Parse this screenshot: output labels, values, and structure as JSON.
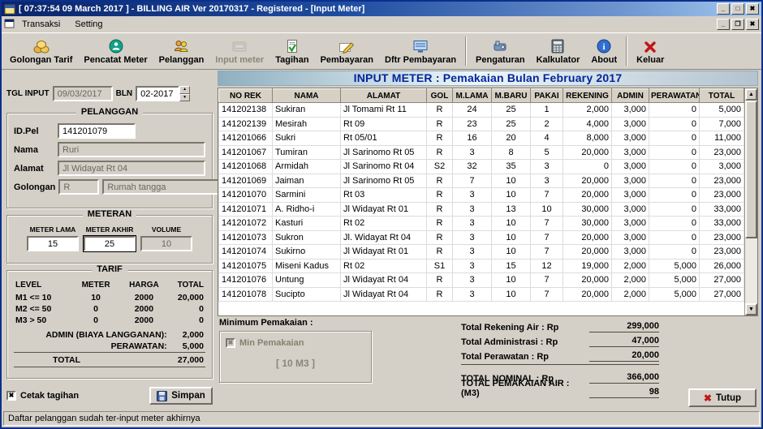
{
  "colors": {
    "titlebar_blue": "#0a246a",
    "header_text_navy": "#00259e",
    "grid_header_bg": "#d6d1c4",
    "close_red": "#c11616",
    "panel_gray": "#d4d0c8"
  },
  "titlebar": {
    "title": "[ 07:37:54  09 March 2017 ]  -  BILLING AIR Ver 20170317  -  Registered - [Input Meter]"
  },
  "menubar": {
    "items": [
      "Transaksi",
      "Setting"
    ]
  },
  "toolbar": {
    "buttons": [
      {
        "label": "Golongan Tarif",
        "icon": "coins-icon"
      },
      {
        "label": "Pencatat Meter",
        "icon": "recorder-icon"
      },
      {
        "label": "Pelanggan",
        "icon": "customers-icon"
      },
      {
        "label": "Input meter",
        "icon": "meter-icon",
        "disabled": true
      },
      {
        "label": "Tagihan",
        "icon": "invoice-check-icon"
      },
      {
        "label": "Pembayaran",
        "icon": "pencil-payment-icon"
      },
      {
        "label": "Dftr Pembayaran",
        "icon": "payment-list-icon"
      },
      {
        "label": "Pengaturan",
        "icon": "settings-tools-icon"
      },
      {
        "label": "Kalkulator",
        "icon": "calculator-icon"
      },
      {
        "label": "About",
        "icon": "info-icon"
      },
      {
        "label": "Keluar",
        "icon": "exit-x-icon"
      }
    ]
  },
  "header": {
    "title": "INPUT METER : Pemakaian Bulan February 2017"
  },
  "form": {
    "tgl_input_label": "TGL INPUT",
    "tgl_input_value": "09/03/2017",
    "bln_label": "BLN",
    "bln_value": "02-2017",
    "pelanggan": {
      "title": "PELANGGAN",
      "id_label": "ID.Pel",
      "id_value": "141201079",
      "nama_label": "Nama",
      "nama_value": "Ruri",
      "alamat_label": "Alamat",
      "alamat_value": "Jl Widayat Rt 04",
      "golongan_label": "Golongan",
      "golongan_code": "R",
      "golongan_name": "Rumah tangga"
    },
    "meteran": {
      "title": "METERAN",
      "meter_lama_label": "METER LAMA",
      "meter_akhir_label": "METER AKHIR",
      "volume_label": "VOLUME",
      "meter_lama": "15",
      "meter_akhir": "25",
      "volume": "10"
    },
    "tarif": {
      "title": "TARIF",
      "headers": [
        "LEVEL",
        "METER",
        "HARGA",
        "TOTAL"
      ],
      "rows": [
        [
          "M1 <= 10",
          "10",
          "2000",
          "20,000"
        ],
        [
          "M2 <= 50",
          "0",
          "2000",
          "0"
        ],
        [
          "M3 > 50",
          "0",
          "2000",
          "0"
        ]
      ],
      "admin_label": "ADMIN (BIAYA LANGGANAN):",
      "admin_value": "2,000",
      "perawatan_label": "PERAWATAN:",
      "perawatan_value": "5,000",
      "total_label": "TOTAL",
      "total_value": "27,000"
    },
    "cetak_label": "Cetak tagihan",
    "simpan_label": "Simpan"
  },
  "grid": {
    "columns": [
      "NO REK",
      "NAMA",
      "ALAMAT",
      "GOL",
      "M.LAMA",
      "M.BARU",
      "PAKAI",
      "REKENING",
      "ADMIN",
      "PERAWATAN",
      "TOTAL"
    ],
    "rows": [
      [
        "141202138",
        "Sukiran",
        "Jl Tomami Rt 11",
        "R",
        "24",
        "25",
        "1",
        "2,000",
        "3,000",
        "0",
        "5,000"
      ],
      [
        "141202139",
        "Mesirah",
        "Rt 09",
        "R",
        "23",
        "25",
        "2",
        "4,000",
        "3,000",
        "0",
        "7,000"
      ],
      [
        "141201066",
        "Sukri",
        "Rt 05/01",
        "R",
        "16",
        "20",
        "4",
        "8,000",
        "3,000",
        "0",
        "11,000"
      ],
      [
        "141201067",
        "Tumiran",
        "Jl Sarinomo Rt 05",
        "R",
        "3",
        "8",
        "5",
        "20,000",
        "3,000",
        "0",
        "23,000"
      ],
      [
        "141201068",
        "Armidah",
        "Jl Sarinomo Rt 04",
        "S2",
        "32",
        "35",
        "3",
        "0",
        "3,000",
        "0",
        "3,000"
      ],
      [
        "141201069",
        "Jaiman",
        "Jl Sarinomo Rt 05",
        "R",
        "7",
        "10",
        "3",
        "20,000",
        "3,000",
        "0",
        "23,000"
      ],
      [
        "141201070",
        "Sarmini",
        "Rt 03",
        "R",
        "3",
        "10",
        "7",
        "20,000",
        "3,000",
        "0",
        "23,000"
      ],
      [
        "141201071",
        "A. Ridho-i",
        "Jl Widayat Rt 01",
        "R",
        "3",
        "13",
        "10",
        "30,000",
        "3,000",
        "0",
        "33,000"
      ],
      [
        "141201072",
        "Kasturi",
        "Rt 02",
        "R",
        "3",
        "10",
        "7",
        "30,000",
        "3,000",
        "0",
        "33,000"
      ],
      [
        "141201073",
        "Sukron",
        "Jl. Widayat Rt 04",
        "R",
        "3",
        "10",
        "7",
        "20,000",
        "3,000",
        "0",
        "23,000"
      ],
      [
        "141201074",
        "Sukirno",
        "Jl Widayat Rt 01",
        "R",
        "3",
        "10",
        "7",
        "20,000",
        "3,000",
        "0",
        "23,000"
      ],
      [
        "141201075",
        "Miseni Kadus",
        "Rt 02",
        "S1",
        "3",
        "15",
        "12",
        "19,000",
        "2,000",
        "5,000",
        "26,000"
      ],
      [
        "141201076",
        "Untung",
        "Jl Widayat Rt 04",
        "R",
        "3",
        "10",
        "7",
        "20,000",
        "2,000",
        "5,000",
        "27,000"
      ],
      [
        "141201078",
        "Sucipto",
        "Jl Widayat Rt 04",
        "R",
        "3",
        "10",
        "7",
        "20,000",
        "2,000",
        "5,000",
        "27,000"
      ]
    ]
  },
  "minimum": {
    "title": "Minimum Pemakaian :",
    "checkbox_label": "Min Pemakaian",
    "value": "[ 10 M3 ]"
  },
  "totals": {
    "rows": [
      {
        "label": "Total Rekening Air : Rp",
        "value": "299,000"
      },
      {
        "label": "Total Administrasi : Rp",
        "value": "47,000"
      },
      {
        "label": "Total Perawatan : Rp",
        "value": "20,000"
      }
    ],
    "nominal_label": "TOTAL NOMINAL : Rp",
    "nominal_value": "366,000",
    "pemakaian_label": "TOTAL PEMAKAIAN AIR : (M3)",
    "pemakaian_value": "98"
  },
  "tutup_label": "Tutup",
  "statusbar": {
    "text": "Daftar pelanggan sudah ter-input meter akhirnya"
  }
}
